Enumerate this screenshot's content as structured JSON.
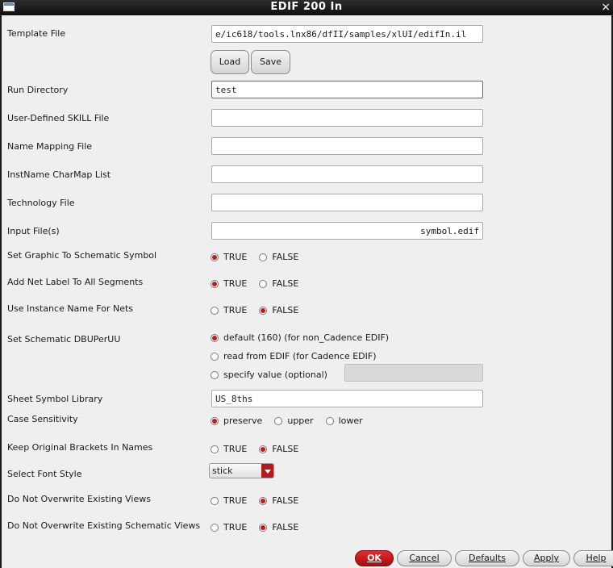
{
  "window": {
    "title": "EDIF 200 In",
    "icon": "window-icon",
    "close": "×"
  },
  "template_file": {
    "label": "Template File",
    "value": "e/ic618/tools.lnx86/dfII/samples/xlUI/edifIn.il",
    "load": "Load",
    "save": "Save"
  },
  "run_directory": {
    "label": "Run Directory",
    "value": "test"
  },
  "skill_file": {
    "label": "User-Defined SKILL File",
    "value": ""
  },
  "name_mapping": {
    "label": "Name Mapping File",
    "value": ""
  },
  "instname_charmap": {
    "label": "InstName CharMap List",
    "value": ""
  },
  "technology_file": {
    "label": "Technology File",
    "value": ""
  },
  "input_files": {
    "label": "Input File(s)",
    "value": "symbol.edif"
  },
  "graphic_to_symbol": {
    "label": "Set Graphic To Schematic Symbol",
    "options": [
      "TRUE",
      "FALSE"
    ],
    "selected": 0
  },
  "net_label": {
    "label": "Add Net Label To All Segments",
    "options": [
      "TRUE",
      "FALSE"
    ],
    "selected": 0
  },
  "instance_name_nets": {
    "label": "Use Instance Name For Nets",
    "options": [
      "TRUE",
      "FALSE"
    ],
    "selected": 1
  },
  "dbu": {
    "label": "Set Schematic DBUPerUU",
    "options": [
      "default (160) (for non_Cadence EDIF)",
      "read from EDIF (for Cadence EDIF)",
      "specify value (optional)"
    ],
    "selected": 0,
    "specify_value": ""
  },
  "sheet_symbol": {
    "label": "Sheet Symbol Library",
    "value": "US_8ths"
  },
  "case_sensitivity": {
    "label": "Case Sensitivity",
    "options": [
      "preserve",
      "upper",
      "lower"
    ],
    "selected": 0
  },
  "keep_brackets": {
    "label": "Keep Original Brackets In Names",
    "options": [
      "TRUE",
      "FALSE"
    ],
    "selected": 1
  },
  "font_style": {
    "label": "Select Font Style",
    "value": "stick"
  },
  "no_overwrite_views": {
    "label": "Do Not Overwrite Existing Views",
    "options": [
      "TRUE",
      "FALSE"
    ],
    "selected": 1
  },
  "no_overwrite_schematic": {
    "label": "Do Not Overwrite Existing Schematic Views",
    "options": [
      "TRUE",
      "FALSE"
    ],
    "selected": 1
  },
  "buttons": {
    "ok": "OK",
    "cancel": "Cancel",
    "defaults": "Defaults",
    "apply": "Apply",
    "help": "Help"
  },
  "colors": {
    "accent": "#c4181b",
    "titlebar": "#1a1a1a",
    "background": "#efefef"
  }
}
